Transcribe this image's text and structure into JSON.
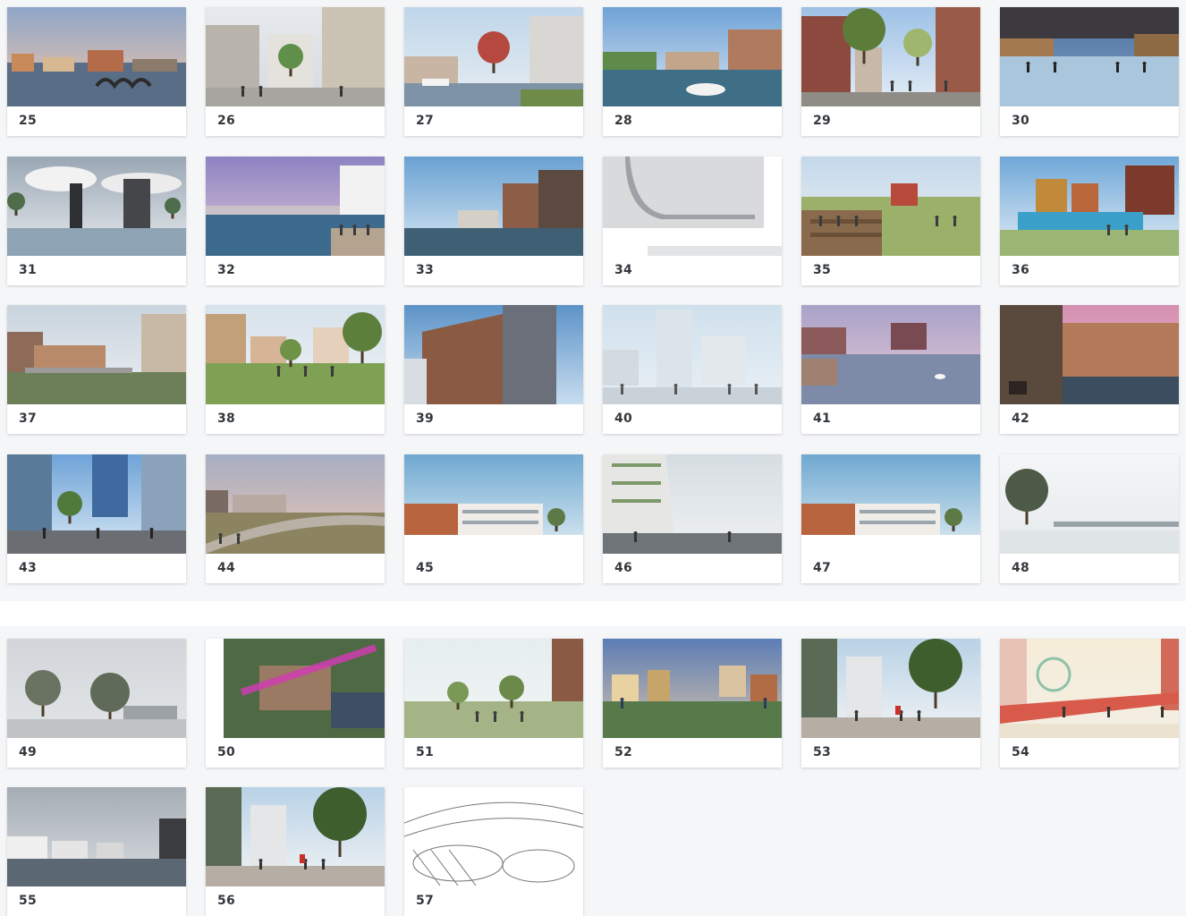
{
  "gallery": {
    "cards": [
      {
        "label": "25",
        "scene": "sunset-harbor"
      },
      {
        "label": "26",
        "scene": "street-buildings"
      },
      {
        "label": "27",
        "scene": "marina-tree"
      },
      {
        "label": "28",
        "scene": "canal-boat"
      },
      {
        "label": "29",
        "scene": "tree-street"
      },
      {
        "label": "30",
        "scene": "ice-skating"
      },
      {
        "label": "31",
        "scene": "cloudy-water-towers"
      },
      {
        "label": "32",
        "scene": "purple-sky-canal"
      },
      {
        "label": "33",
        "scene": "brick-waterfront"
      },
      {
        "label": "34",
        "scene": "grey-model"
      },
      {
        "label": "35",
        "scene": "steps-park"
      },
      {
        "label": "36",
        "scene": "pool-houses"
      },
      {
        "label": "37",
        "scene": "bridge-stream"
      },
      {
        "label": "38",
        "scene": "green-lawn"
      },
      {
        "label": "39",
        "scene": "tall-brick-facade"
      },
      {
        "label": "40",
        "scene": "foggy-tower"
      },
      {
        "label": "41",
        "scene": "pink-lake-swan"
      },
      {
        "label": "42",
        "scene": "pink-pool-interior"
      },
      {
        "label": "43",
        "scene": "blue-courtyard"
      },
      {
        "label": "44",
        "scene": "dusk-marsh-path"
      },
      {
        "label": "45",
        "scene": "white-low-building"
      },
      {
        "label": "46",
        "scene": "misty-terraces"
      },
      {
        "label": "47",
        "scene": "white-low-building"
      },
      {
        "label": "48",
        "scene": "tree-misty-lake"
      },
      {
        "label": "49",
        "scene": "grey-trees-fog"
      },
      {
        "label": "50",
        "scene": "aerial-magenta"
      },
      {
        "label": "51",
        "scene": "light-park-path"
      },
      {
        "label": "52",
        "scene": "colorful-blocks"
      },
      {
        "label": "53",
        "scene": "sunny-promenade"
      },
      {
        "label": "54",
        "scene": "sketch-red-path"
      },
      {
        "label": "55",
        "scene": "grey-harbor-blocks"
      },
      {
        "label": "56",
        "scene": "sunny-promenade"
      },
      {
        "label": "57",
        "scene": "line-sketch"
      }
    ]
  },
  "colors": {
    "panel": "#f5f6f8",
    "label": "#33383d",
    "card": "#ffffff"
  }
}
